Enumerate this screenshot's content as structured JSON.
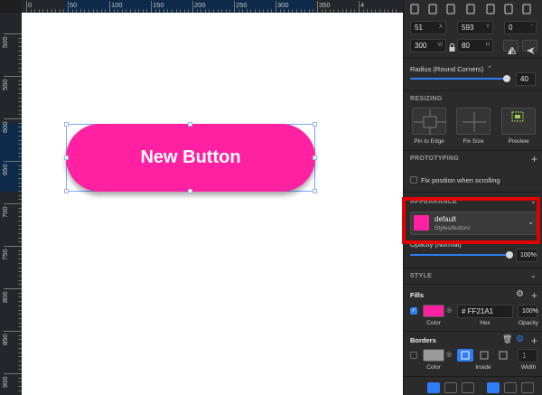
{
  "ruler": {
    "h_labels": [
      "0",
      "50",
      "100",
      "150",
      "200",
      "250",
      "300",
      "350",
      "4"
    ],
    "v_labels": [
      "500",
      "550",
      "600",
      "650",
      "700",
      "750",
      "800",
      "850",
      "900"
    ]
  },
  "canvas": {
    "button": {
      "label": "New Button",
      "fill": "#FF21A1"
    }
  },
  "inspector": {
    "position": {
      "x": "51",
      "x_suffix": "X",
      "y": "593",
      "y_suffix": "Y",
      "rotation": "0",
      "rotation_suffix": "°"
    },
    "size": {
      "w": "300",
      "w_suffix": "W",
      "h": "80",
      "h_suffix": "H"
    },
    "radius": {
      "label": "Radius (Round Corners)",
      "value": "40"
    },
    "resizing": {
      "title": "RESIZING",
      "pin_label": "Pin to Edge",
      "fix_label": "Fix Size",
      "preview_label": "Preview"
    },
    "prototyping": {
      "title": "PROTOTYPING",
      "fix_label": "Fix position when scrolling"
    },
    "appearance": {
      "title": "APPEARANCE",
      "style_name": "default",
      "style_path": "Styles/button/",
      "swatch": "#FF21A1"
    },
    "opacity": {
      "label": "Opacity (Normal)",
      "value": "100%"
    },
    "style": {
      "title": "STYLE"
    },
    "fills": {
      "title": "Fills",
      "hex": "# FF21A1",
      "opacity": "100%",
      "color_label": "Color",
      "hex_label": "Hex",
      "opacity_label": "Opacity"
    },
    "borders": {
      "title": "Borders",
      "width_value": "1",
      "color_label": "Color",
      "inside_label": "Inside",
      "width_label": "Width"
    }
  },
  "colors": {
    "accent": "#2f7df6",
    "highlight": "#e10000",
    "brand_fill": "#FF21A1"
  }
}
